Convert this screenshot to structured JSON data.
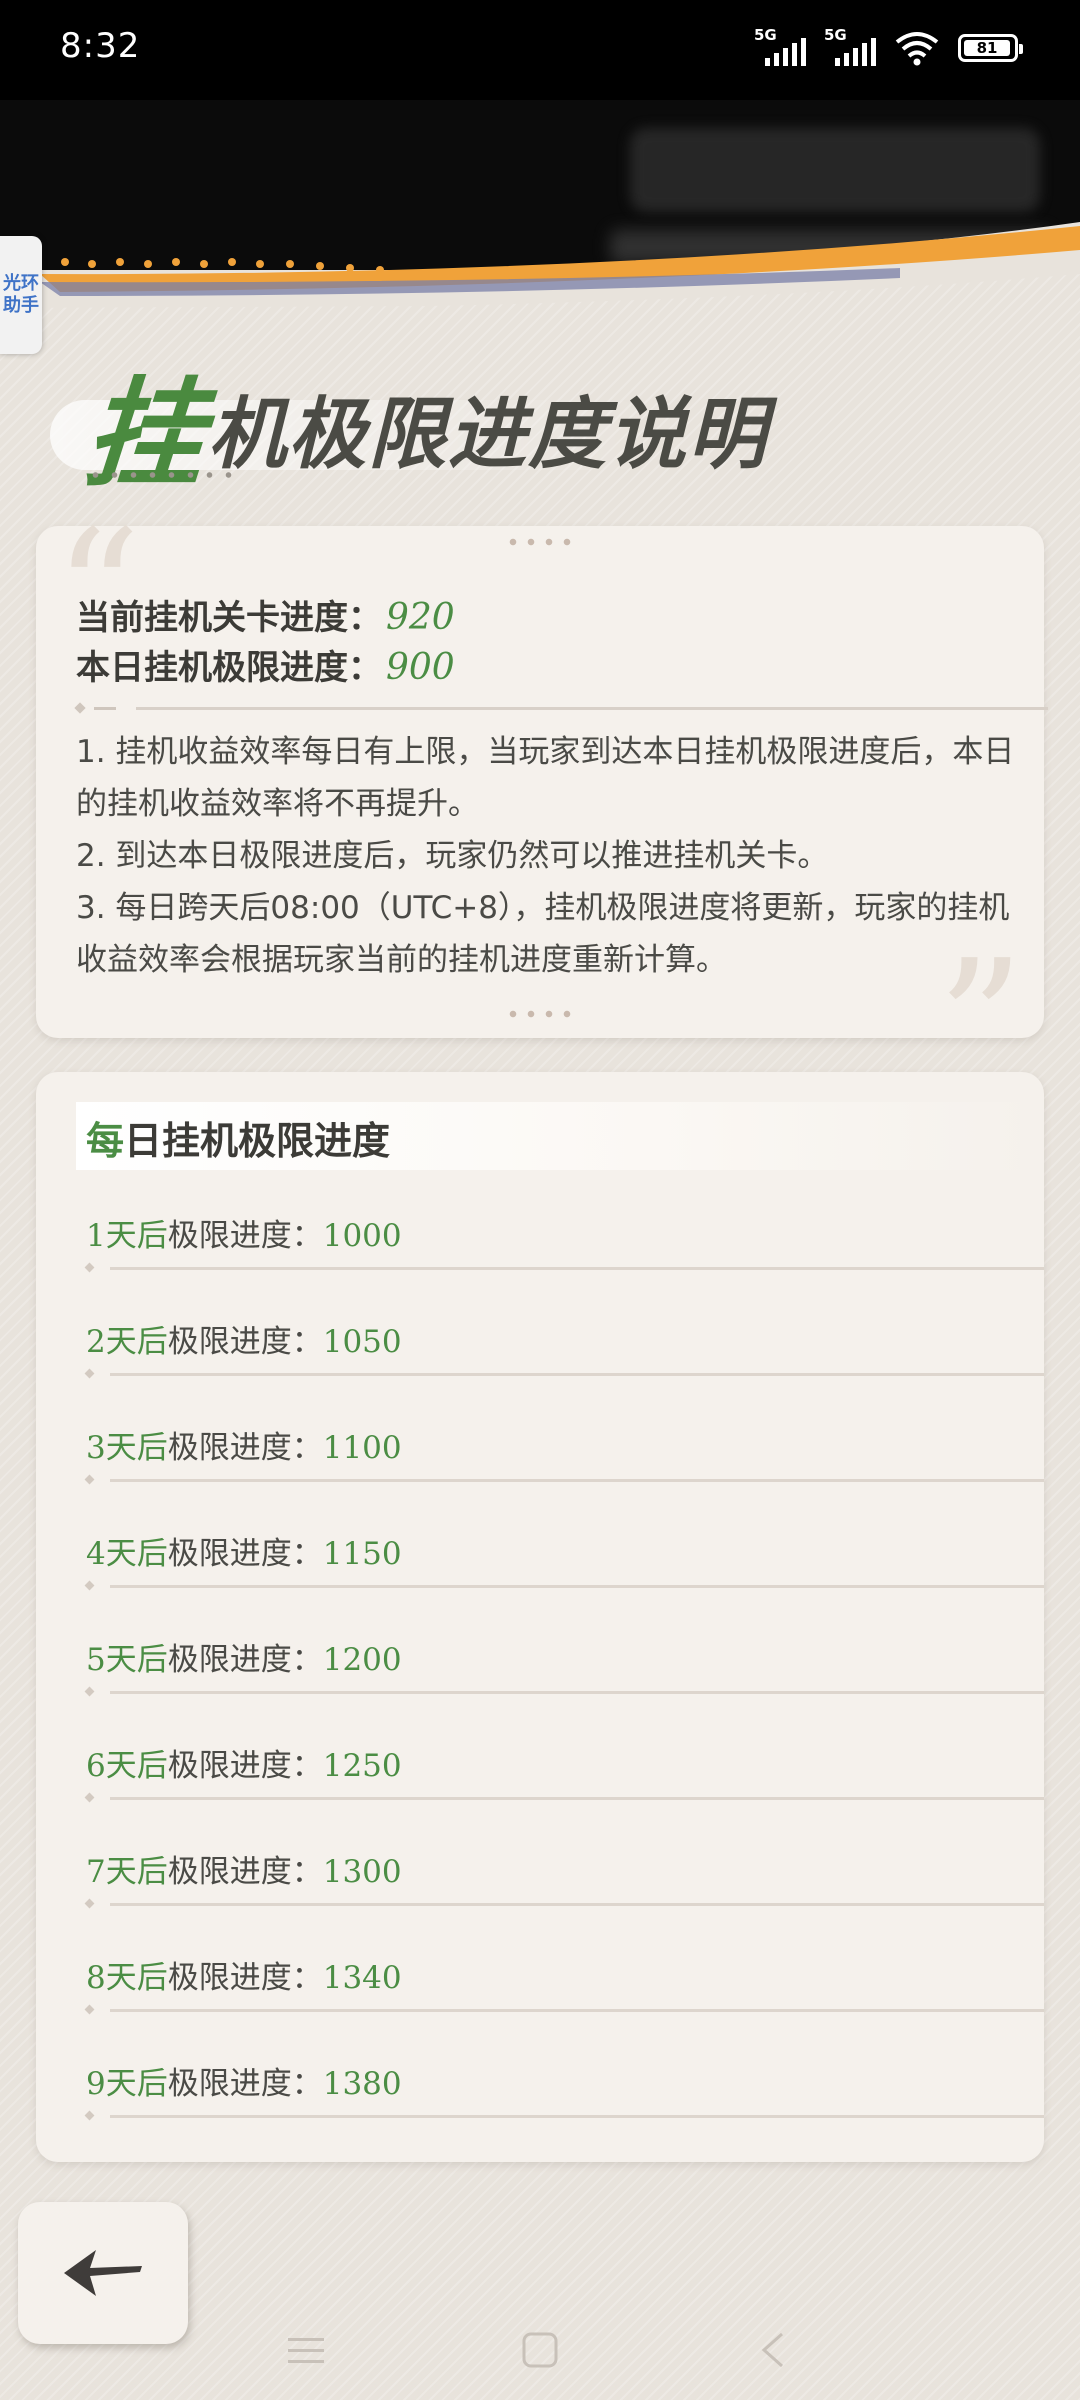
{
  "status_bar": {
    "time": "8:32",
    "network_1": "5G",
    "network_2": "5G",
    "battery_level": "81"
  },
  "side_tab": {
    "label": "光环助手"
  },
  "page": {
    "title_first_char": "挂",
    "title_rest": "机极限进度说明"
  },
  "info_card": {
    "current_stage_label": "当前挂机关卡进度：",
    "current_stage_value": "920",
    "daily_limit_label": "本日挂机极限进度：",
    "daily_limit_value": "900",
    "notes": [
      "1. 挂机收益效率每日有上限，当玩家到达本日挂机极限进度后，本日的挂机收益效率将不再提升。",
      "2. 到达本日极限进度后，玩家仍然可以推进挂机关卡。",
      "3. 每日跨天后08:00（UTC+8），挂机极限进度将更新，玩家的挂机收益效率会根据玩家当前的挂机进度重新计算。"
    ]
  },
  "daily_list": {
    "title_first_char": "每",
    "title_rest": "日挂机极限进度",
    "rows": [
      {
        "day": "1天后",
        "label": "极限进度：",
        "value": "1000"
      },
      {
        "day": "2天后",
        "label": "极限进度：",
        "value": "1050"
      },
      {
        "day": "3天后",
        "label": "极限进度：",
        "value": "1100"
      },
      {
        "day": "4天后",
        "label": "极限进度：",
        "value": "1150"
      },
      {
        "day": "5天后",
        "label": "极限进度：",
        "value": "1200"
      },
      {
        "day": "6天后",
        "label": "极限进度：",
        "value": "1250"
      },
      {
        "day": "7天后",
        "label": "极限进度：",
        "value": "1300"
      },
      {
        "day": "8天后",
        "label": "极限进度：",
        "value": "1340"
      },
      {
        "day": "9天后",
        "label": "极限进度：",
        "value": "1380"
      }
    ]
  },
  "controls": {
    "back_icon": "arrow-left-icon",
    "nav_menu_icon": "menu-icon",
    "nav_home_icon": "home-icon",
    "nav_back_icon": "chevron-left-icon"
  },
  "colors": {
    "accent_green": "#4b8d44",
    "paper": "#e8e3dc",
    "card": "#f5f1ec",
    "wave_orange": "#f0a23a"
  }
}
